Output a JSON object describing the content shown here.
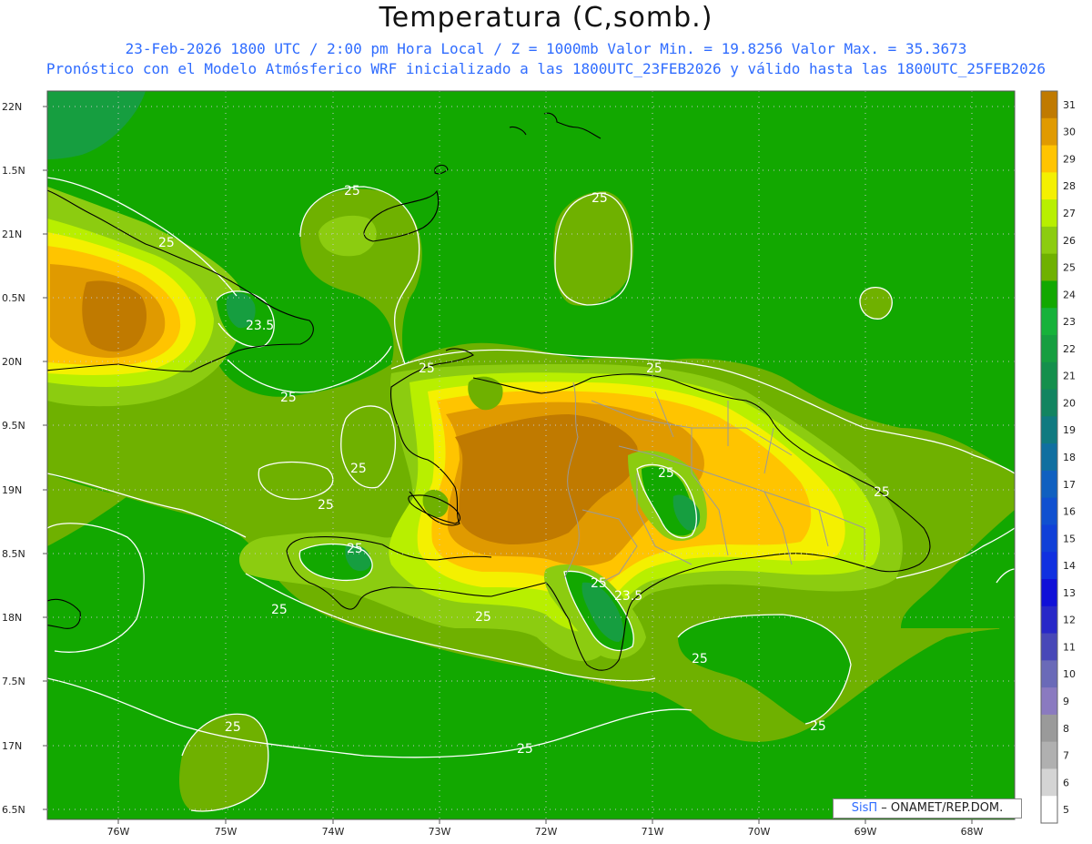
{
  "title": "Temperatura (C,somb.)",
  "subtitle_line1": "23-Feb-2026  1800 UTC / 2:00 pm Hora Local / Z = 1000mb   Valor Min. = 19.8256  Valor Max. = 35.3673",
  "subtitle_line2": "Pronóstico con el Modelo Atmósferico WRF inicializado a las 1800UTC_23FEB2026 y válido hasta las  1800UTC_25FEB2026",
  "credit": {
    "brand": "SisΠ",
    "text": "– ONAMET/REP.DOM."
  },
  "lat_labels": [
    "22N",
    "1.5N",
    "21N",
    "0.5N",
    "20N",
    "9.5N",
    "19N",
    "8.5N",
    "18N",
    "7.5N",
    "17N",
    "6.5N"
  ],
  "lon_labels": [
    "76W",
    "75W",
    "74W",
    "73W",
    "72W",
    "71W",
    "70W",
    "69W",
    "68W"
  ],
  "contour_labels": [
    {
      "text": "25"
    },
    {
      "text": "25"
    },
    {
      "text": "25"
    },
    {
      "text": "23.5"
    },
    {
      "text": "25"
    },
    {
      "text": "25"
    },
    {
      "text": "25"
    },
    {
      "text": "25"
    },
    {
      "text": "25"
    },
    {
      "text": "25"
    },
    {
      "text": "25"
    },
    {
      "text": "23.5"
    },
    {
      "text": "25"
    },
    {
      "text": "25"
    },
    {
      "text": "25"
    },
    {
      "text": "25"
    },
    {
      "text": "25"
    },
    {
      "text": "25"
    },
    {
      "text": "25"
    },
    {
      "text": "25"
    }
  ],
  "colorbar": {
    "values": [
      31,
      30,
      29,
      28,
      27,
      26,
      25,
      24,
      23,
      22,
      21,
      20,
      19,
      18,
      17,
      16,
      15,
      14,
      13,
      12,
      11,
      10,
      9,
      8,
      7,
      6,
      5
    ],
    "colors": [
      "#c07a00",
      "#e09a00",
      "#ffc400",
      "#f4f000",
      "#b8ef00",
      "#8ccc10",
      "#6fb100",
      "#12a800",
      "#16b23a",
      "#169e40",
      "#148f4c",
      "#128460",
      "#107a80",
      "#106fa0",
      "#1060c0",
      "#1050d0",
      "#1040d8",
      "#1030e0",
      "#1010d8",
      "#2828c8",
      "#4848b8",
      "#6a6ab8",
      "#8a7ac0",
      "#9a9a9a",
      "#b0b0b0",
      "#d4d4d4",
      "#ffffff"
    ]
  },
  "field_colors": {
    "base": "#6fb100",
    "cool": "#12a800",
    "cooler": "#169e40",
    "warm": "#8ccc10",
    "warmer": "#b8ef00",
    "yellow": "#f4f000",
    "gold": "#ffc400",
    "orange": "#e09a00",
    "brown": "#c07a00"
  }
}
